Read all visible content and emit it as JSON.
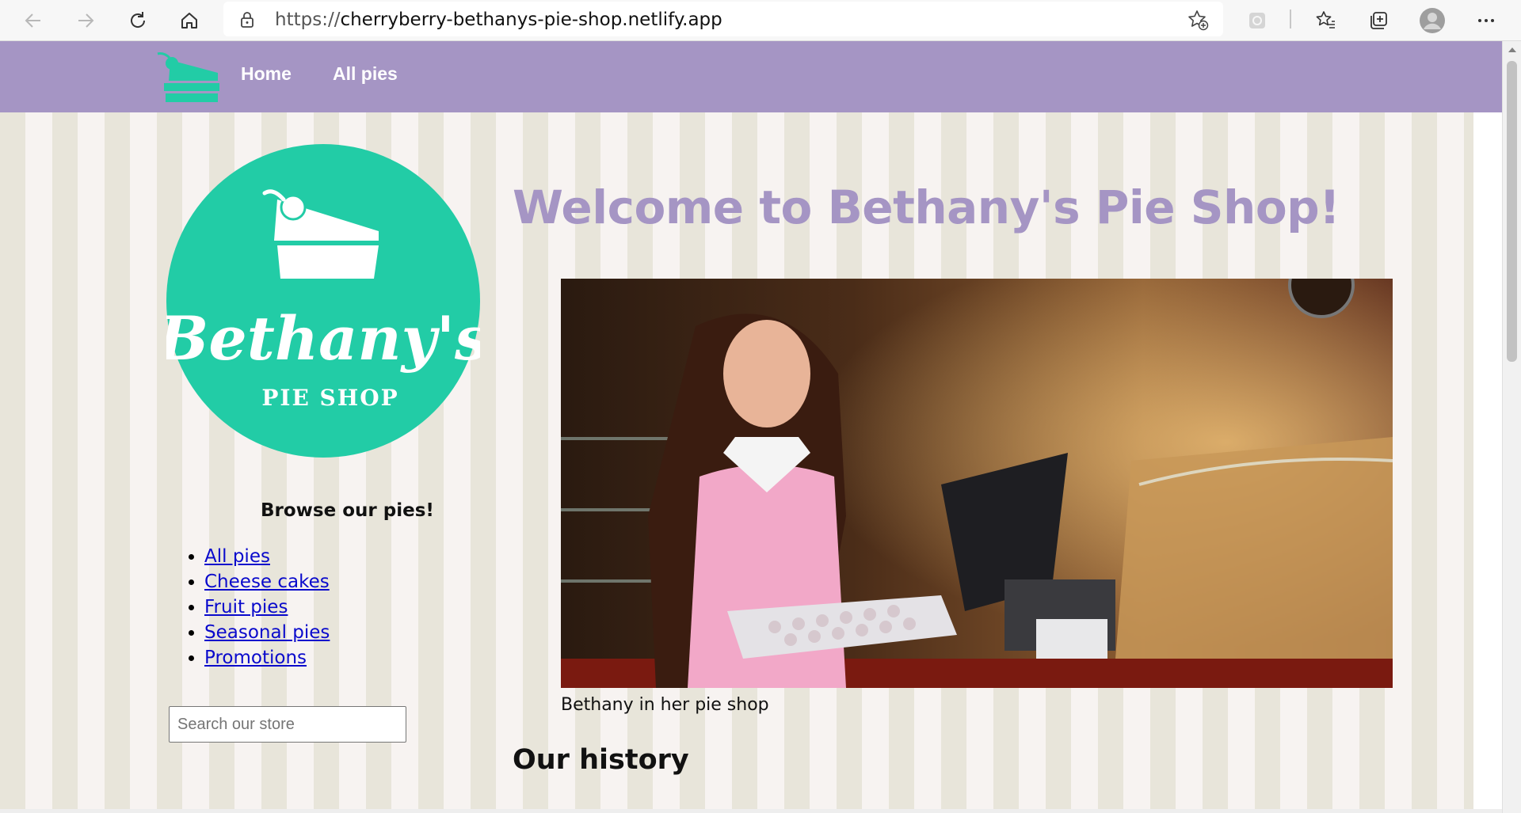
{
  "browser": {
    "url_prefix": "https://",
    "url_domain": "cherryberry-bethanys-pie-shop.netlify.app",
    "icons": [
      "back-icon",
      "forward-icon",
      "refresh-icon",
      "home-icon",
      "lock-icon",
      "add-favorite-icon",
      "extension-icon",
      "favorites-icon",
      "collections-icon",
      "profile-icon",
      "more-icon"
    ]
  },
  "header": {
    "nav": [
      "Home",
      "All pies"
    ]
  },
  "logo": {
    "word": "Bethany's",
    "sub": "Pie Shop"
  },
  "sidebar": {
    "browse_title": "Browse our pies!",
    "categories": [
      "All pies",
      "Cheese cakes",
      "Fruit pies",
      "Seasonal pies",
      "Promotions"
    ],
    "search_placeholder": "Search our store"
  },
  "main": {
    "welcome": "Welcome to Bethany's Pie Shop!",
    "caption": "Bethany in her pie shop",
    "history_title": "Our history"
  },
  "colors": {
    "header": "#a595c4",
    "brand_green": "#22cca6",
    "stripe_dark": "#e8e5da",
    "stripe_light": "#f7f3f1",
    "link": "#0a0acc"
  }
}
